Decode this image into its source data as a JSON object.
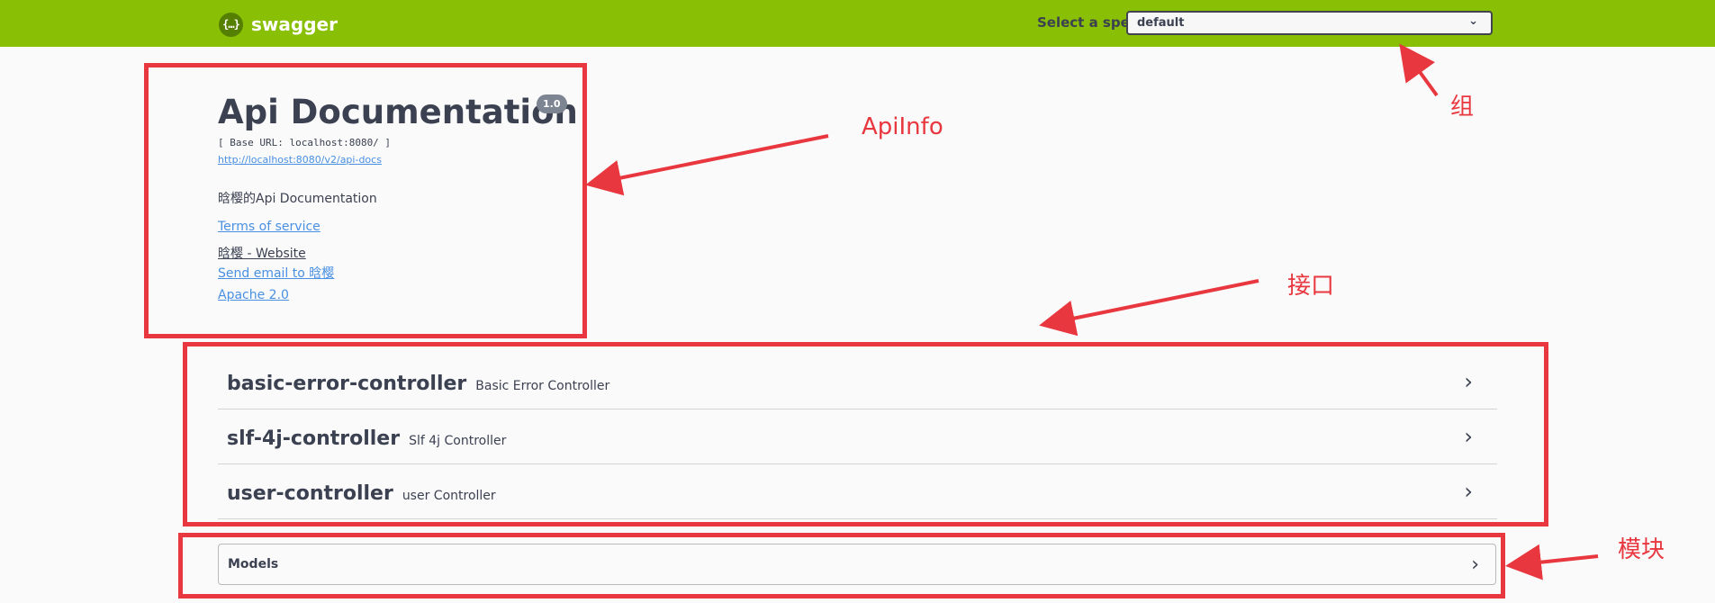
{
  "topbar": {
    "logo_glyph": "{…}",
    "logo_text": "swagger",
    "spec_label": "Select a spec",
    "spec_value": "default",
    "accent_color": "#89bf04"
  },
  "info": {
    "title": "Api Documentation",
    "version": "1.0",
    "base_url": "[ Base URL: localhost:8080/ ]",
    "api_docs_link": "http://localhost:8080/v2/api-docs",
    "description": "晗樱的Api Documentation",
    "terms": "Terms of service",
    "website": "晗樱 - Website",
    "email": "Send email to 晗樱",
    "license": "Apache 2.0"
  },
  "tags": [
    {
      "name": "basic-error-controller",
      "description": "Basic Error Controller"
    },
    {
      "name": "slf-4j-controller",
      "description": "Slf 4j Controller"
    },
    {
      "name": "user-controller",
      "description": "user Controller"
    }
  ],
  "models": {
    "title": "Models"
  },
  "annotations": {
    "group": "组",
    "apiinfo": "ApiInfo",
    "interface": "接口",
    "module": "模块",
    "color": "#e8373f"
  }
}
